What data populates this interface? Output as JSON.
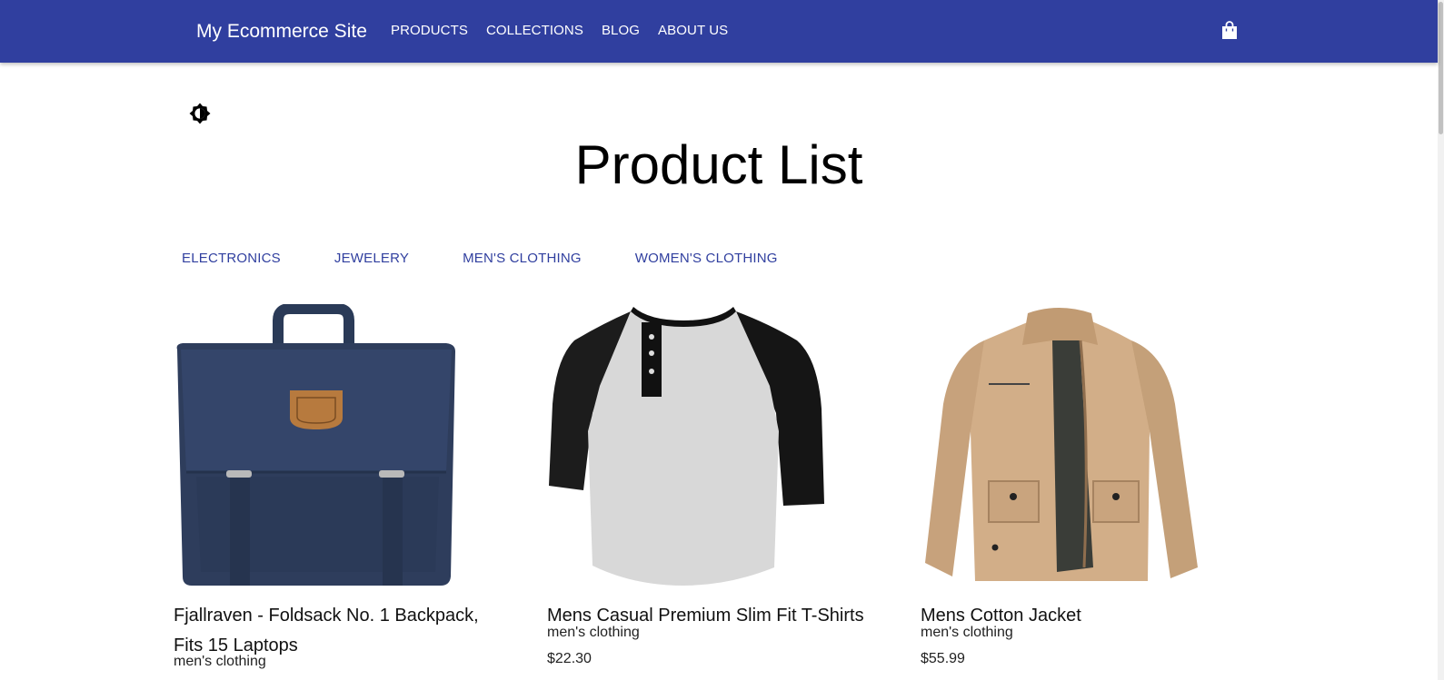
{
  "header": {
    "brand": "My Ecommerce Site",
    "nav": [
      "PRODUCTS",
      "COLLECTIONS",
      "BLOG",
      "ABOUT US"
    ],
    "cart_icon": "shopping-bag-icon",
    "color": "#303f9f"
  },
  "theme_toggle": {
    "icon": "brightness-icon"
  },
  "page_title": "Product List",
  "categories": [
    "ELECTRONICS",
    "JEWELERY",
    "MEN'S CLOTHING",
    "WOMEN'S CLOTHING"
  ],
  "products": [
    {
      "title": "Fjallraven - Foldsack No. 1 Backpack, Fits 15 Laptops",
      "category": "men's clothing",
      "price": "",
      "image": "backpack"
    },
    {
      "title": "Mens Casual Premium Slim Fit T-Shirts",
      "category": "men's clothing",
      "price": "$22.30",
      "image": "raglan-tshirt"
    },
    {
      "title": "Mens Cotton Jacket",
      "category": "men's clothing",
      "price": "$55.99",
      "image": "cotton-jacket"
    }
  ]
}
